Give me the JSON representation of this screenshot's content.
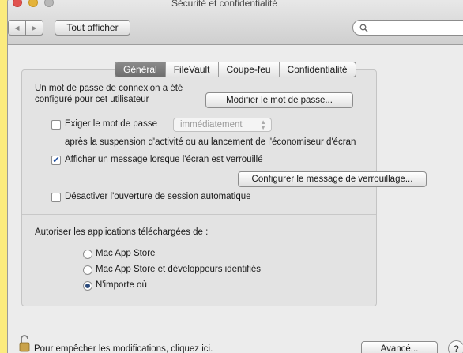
{
  "window": {
    "title": "Sécurité et confidentialité"
  },
  "toolbar": {
    "back_glyph": "◀",
    "forward_glyph": "▶",
    "show_all_label": "Tout afficher",
    "search_placeholder": ""
  },
  "tabs": [
    {
      "label": "Général",
      "active": true
    },
    {
      "label": "FileVault",
      "active": false
    },
    {
      "label": "Coupe-feu",
      "active": false
    },
    {
      "label": "Confidentialité",
      "active": false
    }
  ],
  "general": {
    "password_set_line1": "Un mot de passe de connexion a été",
    "password_set_line2": "configuré pour cet utilisateur",
    "change_password_button": "Modifier le mot de passe...",
    "require_password": {
      "label": "Exiger le mot de passe",
      "checked": false,
      "selected": "immédiatement"
    },
    "require_password_after": "après la suspension d'activité ou au lancement de l'économiseur d'écran",
    "show_message": {
      "label": "Afficher un message lorsque l'écran est verrouillé",
      "checked": true
    },
    "configure_lock_message_button": "Configurer le message de verrouillage...",
    "disable_auto_login": {
      "label": "Désactiver l'ouverture de session automatique",
      "checked": false
    },
    "allow_apps_label": "Autoriser les applications téléchargées de :",
    "allow_apps_options": [
      {
        "label": "Mac App Store",
        "selected": false
      },
      {
        "label": "Mac App Store et développeurs identifiés",
        "selected": false
      },
      {
        "label": "N'importe où",
        "selected": true
      }
    ]
  },
  "footer": {
    "lock_text": "Pour empêcher les modifications, cliquez ici.",
    "advanced_button": "Avancé...",
    "help_glyph": "?"
  },
  "colors": {
    "background": "#fbeb7e",
    "window": "#ececec",
    "active_tab": "#7a7a7a"
  }
}
